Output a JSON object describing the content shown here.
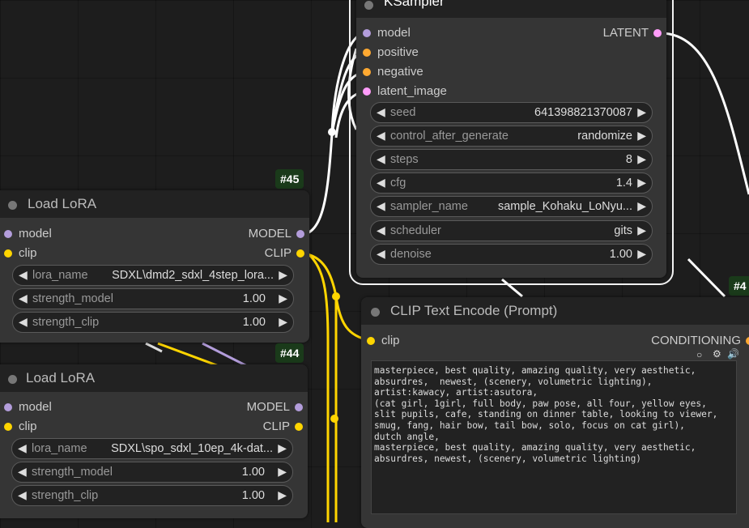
{
  "ksampler": {
    "title": "KSampler",
    "inputs": [
      "model",
      "positive",
      "negative",
      "latent_image"
    ],
    "output": "LATENT",
    "widgets": [
      {
        "label": "seed",
        "value": "641398821370087"
      },
      {
        "label": "control_after_generate",
        "value": "randomize"
      },
      {
        "label": "steps",
        "value": "8"
      },
      {
        "label": "cfg",
        "value": "1.4"
      },
      {
        "label": "sampler_name",
        "value": "sample_Kohaku_LoNyu..."
      },
      {
        "label": "scheduler",
        "value": "gits"
      },
      {
        "label": "denoise",
        "value": "1.00"
      }
    ]
  },
  "lora1": {
    "badge": "#45",
    "title": "Load LoRA",
    "inputs": [
      "model",
      "clip"
    ],
    "outputs": [
      "MODEL",
      "CLIP"
    ],
    "widgets": [
      {
        "label": "lora_name",
        "value": "SDXL\\dmd2_sdxl_4step_lora..."
      },
      {
        "label": "strength_model",
        "value": "1.00"
      },
      {
        "label": "strength_clip",
        "value": "1.00"
      }
    ]
  },
  "lora2": {
    "badge": "#44",
    "title": "Load LoRA",
    "inputs": [
      "model",
      "clip"
    ],
    "outputs": [
      "MODEL",
      "CLIP"
    ],
    "widgets": [
      {
        "label": "lora_name",
        "value": "SDXL\\spo_sdxl_10ep_4k-dat..."
      },
      {
        "label": "strength_model",
        "value": "1.00"
      },
      {
        "label": "strength_clip",
        "value": "1.00"
      }
    ]
  },
  "clip": {
    "badge": "#4",
    "title": "CLIP Text Encode (Prompt)",
    "input": "clip",
    "output": "CONDITIONING",
    "toolbar": [
      "circle-icon",
      "gear-icon",
      "speaker-icon"
    ],
    "text": "masterpiece, best quality, amazing quality, very aesthetic,\nabsurdres,  newest, (scenery, volumetric lighting),\nartist:kawacy, artist:asutora,\n(cat girl, 1girl, full body, paw pose, all four, yellow eyes, slit pupils, cafe, standing on dinner table, looking to viewer, smug, fang, hair bow, tail bow, solo, focus on cat girl),\ndutch angle,\nmasterpiece, best quality, amazing quality, very aesthetic,\nabsurdres, newest, (scenery, volumetric lighting)"
  },
  "colors": {
    "model": "#b39ddb",
    "clip": "#ffd500",
    "conditioning": "#ffa931",
    "latent": "#ff9cf9",
    "link_white": "#ffffff",
    "link_yellow": "#ffd500"
  }
}
